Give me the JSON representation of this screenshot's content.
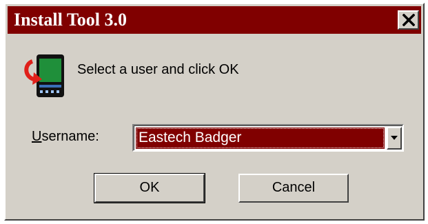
{
  "window": {
    "title": "Install Tool 3.0",
    "close_glyph": "close-icon"
  },
  "dialog": {
    "icon": "handheld-device-sync-icon",
    "prompt": "Select a user and click OK",
    "username_label_accel": "U",
    "username_label_rest": "sername:",
    "username_value": "Eastech Badger"
  },
  "buttons": {
    "ok_label": "OK",
    "cancel_label": "Cancel"
  },
  "colors": {
    "titlebar": "#800000",
    "selection": "#800000",
    "face": "#d4d0c8"
  }
}
